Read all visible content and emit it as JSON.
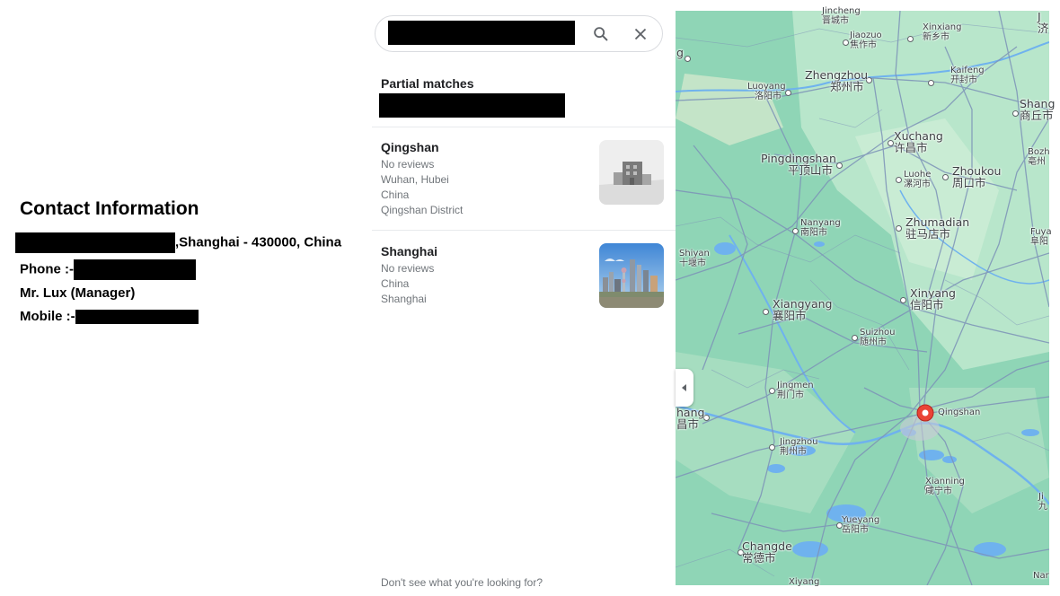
{
  "contact": {
    "title": "Contact Information",
    "address_suffix": ",Shanghai - 430000, China",
    "phone_label": "Phone :-",
    "manager": "Mr. Lux (Manager)",
    "mobile_label": "Mobile :-"
  },
  "panel": {
    "section_title": "Partial matches",
    "results": [
      {
        "name": "Qingshan",
        "lines": [
          "No reviews",
          "Wuhan, Hubei",
          "China",
          "Qingshan District"
        ]
      },
      {
        "name": "Shanghai",
        "lines": [
          "No reviews",
          "China",
          "Shanghai"
        ]
      }
    ],
    "footer": "Don't see what you're looking for?"
  },
  "map": {
    "labels": [
      {
        "en": "Jincheng",
        "zh": "晋城市",
        "size": "sm"
      },
      {
        "en": "Jiaozuo",
        "zh": "焦作市",
        "size": "sm"
      },
      {
        "en": "Xinxiang",
        "zh": "新乡市",
        "size": "sm"
      },
      {
        "en": "Zhengzhou",
        "zh": "郑州市",
        "size": "big"
      },
      {
        "en": "Kaifeng",
        "zh": "开封市",
        "size": "sm"
      },
      {
        "en": "Luoyang",
        "zh": "洛阳市",
        "size": "sm"
      },
      {
        "en": "Shang",
        "zh": "商丘市",
        "size": "big"
      },
      {
        "en": "Xuchang",
        "zh": "许昌市",
        "size": "big"
      },
      {
        "en": "Pingdingshan",
        "zh": "平顶山市",
        "size": "big"
      },
      {
        "en": "Luohe",
        "zh": "漯河市",
        "size": "sm"
      },
      {
        "en": "Zhoukou",
        "zh": "周口市",
        "size": "big"
      },
      {
        "en": "Bozh",
        "zh": "亳州",
        "size": "sm"
      },
      {
        "en": "Nanyang",
        "zh": "南阳市",
        "size": "sm"
      },
      {
        "en": "Zhumadian",
        "zh": "驻马店市",
        "size": "big"
      },
      {
        "en": "Fuya",
        "zh": "阜阳",
        "size": "sm"
      },
      {
        "en": "Shiyan",
        "zh": "十堰市",
        "size": "sm"
      },
      {
        "en": "Xinyang",
        "zh": "信阳市",
        "size": "big"
      },
      {
        "en": "Xiangyang",
        "zh": "襄阳市",
        "size": "big"
      },
      {
        "en": "Suizhou",
        "zh": "随州市",
        "size": "sm"
      },
      {
        "en": "Jingmen",
        "zh": "荆门市",
        "size": "sm"
      },
      {
        "en": "hang",
        "zh": "昌市",
        "size": "big"
      },
      {
        "en": "Qingshan",
        "zh": "",
        "size": "sm"
      },
      {
        "en": "Jingzhou",
        "zh": "荆州市",
        "size": "sm"
      },
      {
        "en": "Xianning",
        "zh": "咸宁市",
        "size": "sm"
      },
      {
        "en": "Yueyang",
        "zh": "岳阳市",
        "size": "sm"
      },
      {
        "en": "Changde",
        "zh": "常德市",
        "size": "big"
      },
      {
        "en": "J",
        "zh": "济",
        "size": "big"
      },
      {
        "en": "g",
        "zh": "",
        "size": "big"
      },
      {
        "en": "Ji",
        "zh": "九",
        "size": "sm"
      },
      {
        "en": "Nar",
        "zh": "",
        "size": "sm"
      },
      {
        "en": "Xiyang",
        "zh": "",
        "size": "sm"
      }
    ],
    "colors": {
      "land": "#8fd5b6",
      "road": "#7d93b8",
      "river": "#6fb2ee",
      "pin": "#ea4335"
    }
  }
}
